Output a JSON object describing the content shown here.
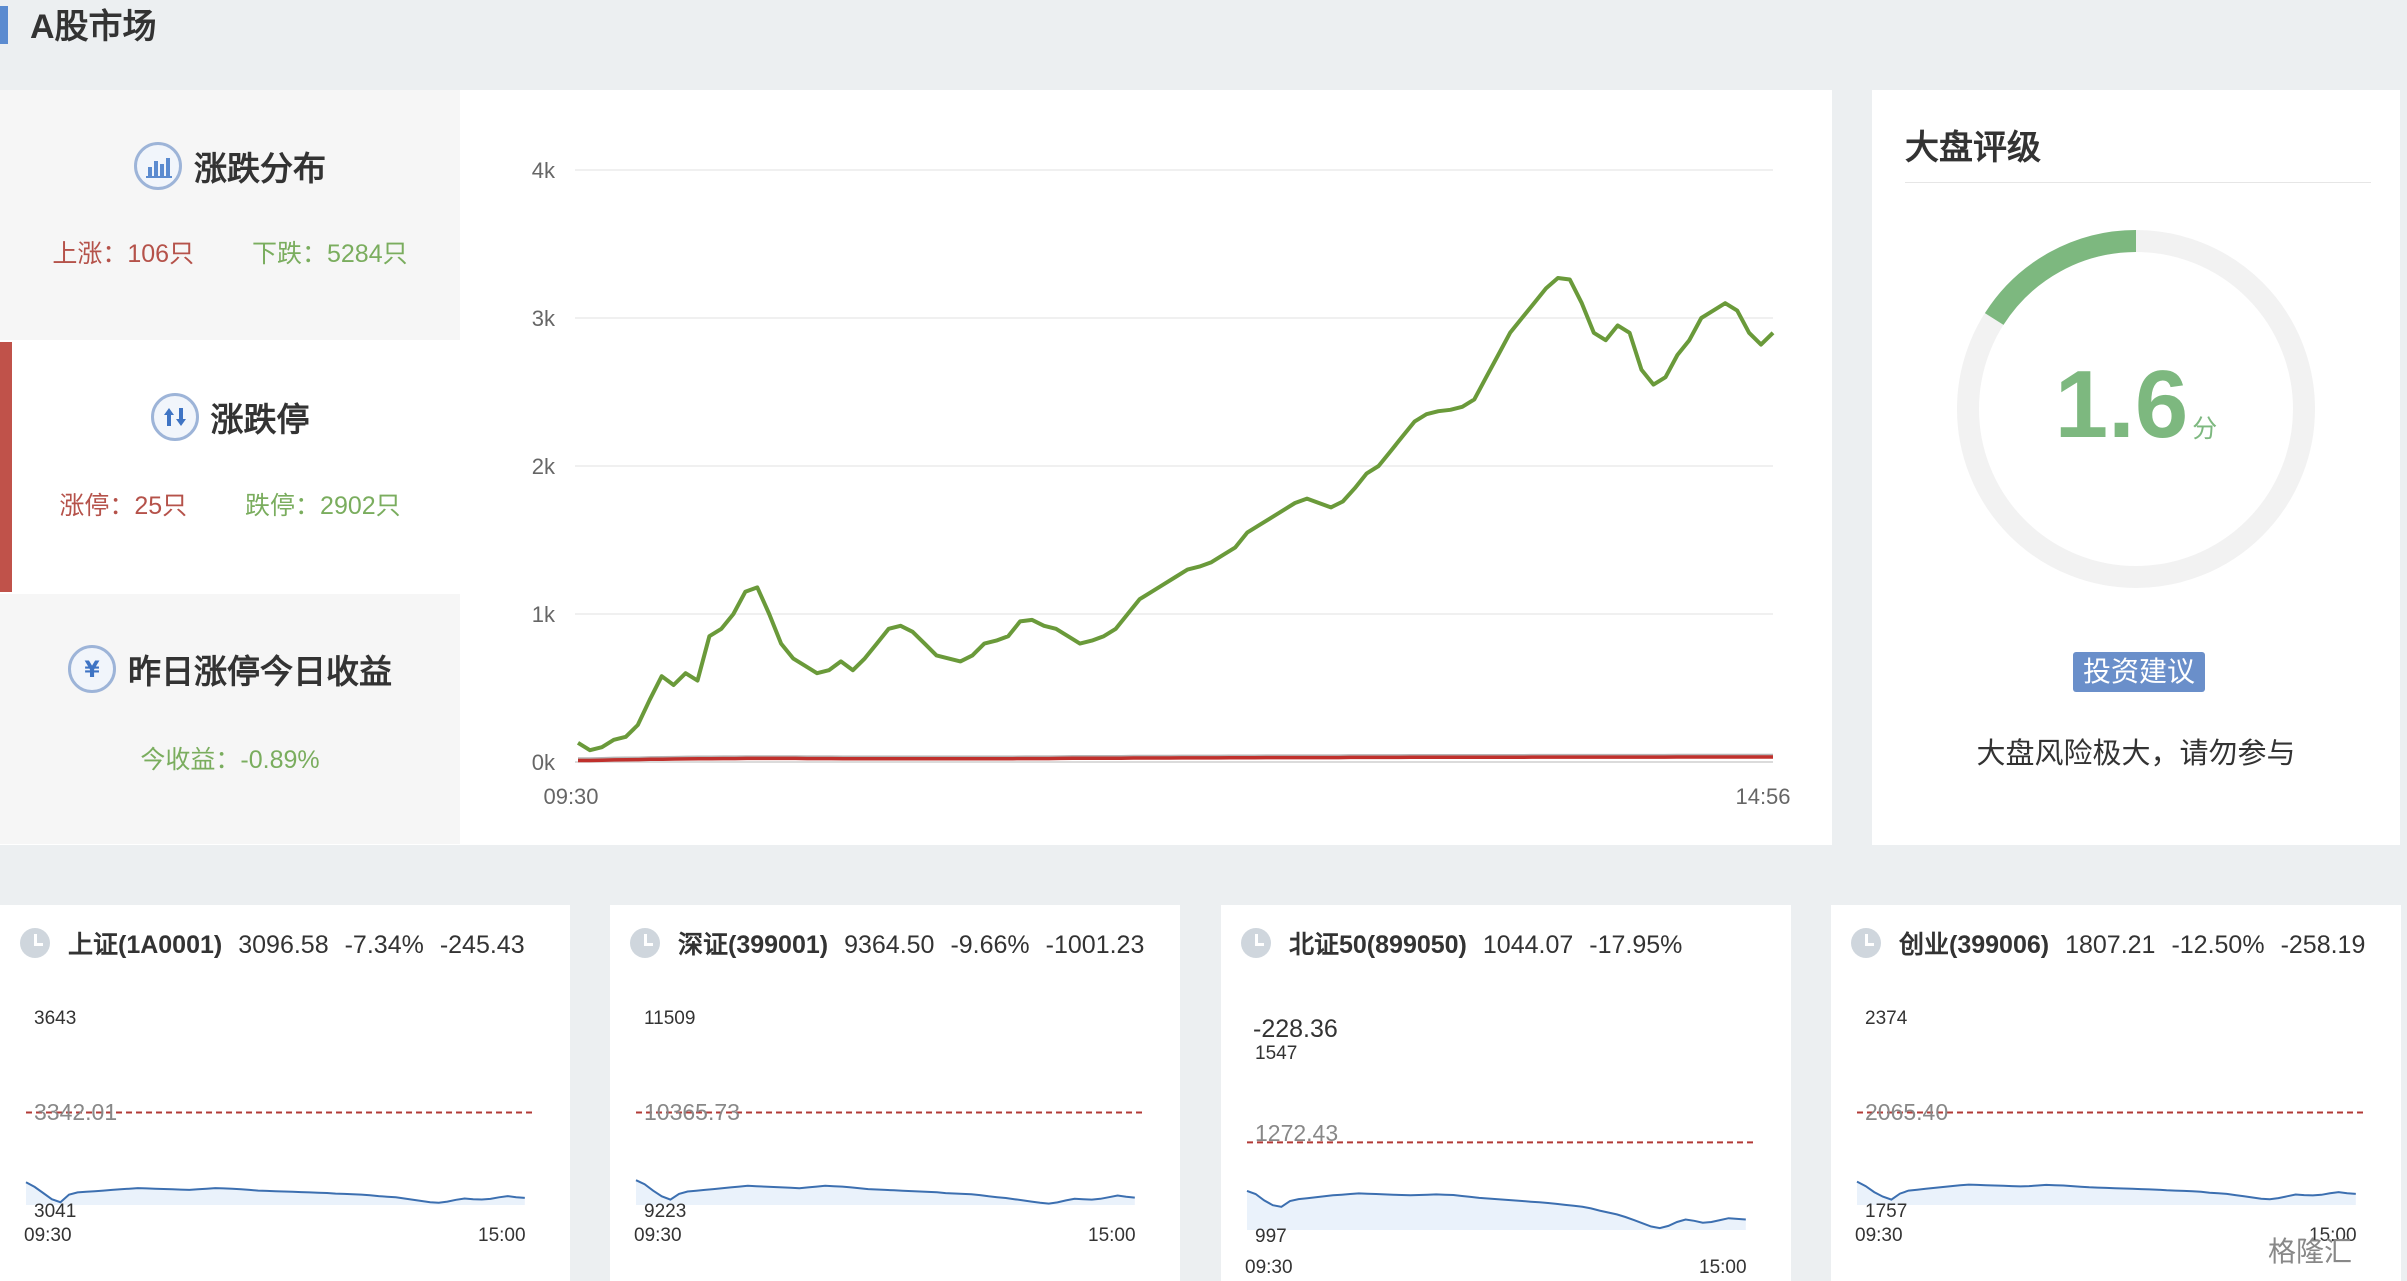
{
  "page": {
    "title": "A股市场"
  },
  "stats": [
    {
      "title": "涨跌分布",
      "icon": "bar-chart-icon",
      "left_label": "上涨：106只",
      "right_label": "下跌：5284只"
    },
    {
      "title": "涨跌停",
      "icon": "up-down-arrows-icon",
      "left_label": "涨停：25只",
      "right_label": "跌停：2902只"
    },
    {
      "title": "昨日涨停今日收益",
      "icon": "yen-icon",
      "left_label": "今收益：-0.89%",
      "right_label": ""
    }
  ],
  "chart_data": [
    {
      "type": "line",
      "title": "",
      "xlabel": "",
      "ylabel": "",
      "x_tick_labels": [
        "09:30",
        "14:56"
      ],
      "y_tick_labels": [
        "0k",
        "1k",
        "2k",
        "3k",
        "4k"
      ],
      "ylim": [
        0,
        4000
      ],
      "grid": true,
      "series": [
        {
          "color": "#6a9a3a",
          "values": [
            130,
            80,
            100,
            150,
            170,
            250,
            420,
            580,
            520,
            600,
            550,
            850,
            900,
            1000,
            1150,
            1180,
            1000,
            800,
            700,
            650,
            600,
            620,
            680,
            620,
            700,
            800,
            900,
            920,
            880,
            800,
            720,
            700,
            680,
            720,
            800,
            820,
            850,
            950,
            960,
            920,
            900,
            850,
            800,
            820,
            850,
            900,
            1000,
            1100,
            1150,
            1200,
            1250,
            1300,
            1320,
            1350,
            1400,
            1450,
            1550,
            1600,
            1650,
            1700,
            1750,
            1780,
            1750,
            1720,
            1760,
            1850,
            1950,
            2000,
            2100,
            2200,
            2300,
            2350,
            2370,
            2380,
            2400,
            2450,
            2600,
            2750,
            2900,
            3000,
            3100,
            3200,
            3270,
            3260,
            3100,
            2900,
            2850,
            2950,
            2900,
            2650,
            2550,
            2600,
            2750,
            2850,
            3000,
            3050,
            3100,
            3050,
            2900,
            2820,
            2900
          ]
        },
        {
          "color": "#c0302c",
          "values": [
            10,
            10,
            12,
            14,
            15,
            16,
            18,
            19,
            20,
            21,
            22,
            22,
            23,
            23,
            24,
            24,
            24,
            24,
            24,
            23,
            23,
            23,
            22,
            22,
            22,
            22,
            22,
            22,
            22,
            22,
            22,
            22,
            22,
            22,
            22,
            22,
            22,
            23,
            23,
            23,
            24,
            25,
            25,
            26,
            26,
            26,
            27,
            27,
            27,
            27,
            28,
            28,
            28,
            28,
            29,
            29,
            29,
            30,
            30,
            30,
            30,
            30,
            30,
            30,
            31,
            31,
            31,
            31,
            31,
            32,
            32,
            32,
            32,
            32,
            32,
            32,
            32,
            32,
            32,
            33,
            33,
            33,
            33,
            33,
            33,
            33,
            33,
            33,
            33,
            33,
            33,
            34,
            34,
            34,
            34,
            34,
            34,
            34,
            34,
            34
          ]
        },
        {
          "color": "#b5b5b5",
          "values": [
            20,
            20,
            22,
            24,
            25,
            26,
            28,
            29,
            30,
            31,
            32,
            32,
            33,
            33,
            34,
            34,
            34,
            34,
            34,
            33,
            33,
            33,
            32,
            32,
            32,
            32,
            32,
            32,
            32,
            32,
            32,
            32,
            32,
            32,
            32,
            32,
            32,
            33,
            33,
            33,
            34,
            35,
            35,
            36,
            36,
            36,
            37,
            37,
            37,
            37,
            38,
            38,
            38,
            38,
            39,
            39,
            39,
            40,
            40,
            40,
            40,
            40,
            40,
            40,
            41,
            41,
            41,
            41,
            41,
            42,
            42,
            42,
            42,
            42,
            42,
            42,
            42,
            42,
            42,
            43,
            43,
            43,
            43,
            43,
            43,
            43,
            43,
            43,
            43,
            43,
            43,
            44,
            44,
            44,
            44,
            44,
            44,
            44,
            44,
            44
          ]
        }
      ]
    },
    {
      "type": "line",
      "title": "上证(1A0001)",
      "x_tick_labels": [
        "09:30",
        "15:00"
      ],
      "ylim": [
        3041,
        3643
      ],
      "reference": 3342.01,
      "series": [
        {
          "color": "#3c6fb0",
          "values": [
            3115,
            3100,
            3080,
            3060,
            3050,
            3075,
            3082,
            3084,
            3086,
            3088,
            3090,
            3092,
            3094,
            3096,
            3095,
            3094,
            3093,
            3092,
            3091,
            3090,
            3092,
            3094,
            3096,
            3095,
            3094,
            3092,
            3090,
            3088,
            3087,
            3086,
            3085,
            3084,
            3083,
            3082,
            3081,
            3080,
            3078,
            3077,
            3076,
            3075,
            3073,
            3070,
            3068,
            3066,
            3062,
            3058,
            3054,
            3050,
            3048,
            3052,
            3058,
            3062,
            3060,
            3059,
            3061,
            3066,
            3070,
            3066,
            3064
          ]
        }
      ]
    },
    {
      "type": "line",
      "title": "深证(399001)",
      "x_tick_labels": [
        "09:30",
        "15:00"
      ],
      "ylim": [
        9223,
        11509
      ],
      "reference": 10365.73,
      "series": [
        {
          "color": "#3c6fb0",
          "values": [
            9530,
            9480,
            9400,
            9330,
            9290,
            9360,
            9390,
            9400,
            9410,
            9420,
            9430,
            9440,
            9450,
            9460,
            9455,
            9450,
            9445,
            9440,
            9435,
            9430,
            9440,
            9450,
            9460,
            9455,
            9450,
            9440,
            9430,
            9420,
            9415,
            9410,
            9405,
            9400,
            9395,
            9390,
            9385,
            9380,
            9370,
            9365,
            9360,
            9355,
            9345,
            9330,
            9320,
            9310,
            9295,
            9280,
            9265,
            9250,
            9240,
            9255,
            9280,
            9300,
            9295,
            9290,
            9300,
            9320,
            9340,
            9325,
            9315
          ]
        }
      ]
    },
    {
      "type": "line",
      "title": "北证50(899050)",
      "x_tick_labels": [
        "09:30",
        "15:00"
      ],
      "ylim": [
        997,
        1547
      ],
      "reference": 1272.43,
      "series": [
        {
          "color": "#3c6fb0",
          "values": [
            1120,
            1110,
            1090,
            1075,
            1070,
            1088,
            1094,
            1097,
            1100,
            1103,
            1106,
            1108,
            1110,
            1112,
            1111,
            1110,
            1109,
            1108,
            1107,
            1106,
            1107,
            1108,
            1109,
            1108,
            1107,
            1104,
            1101,
            1098,
            1096,
            1094,
            1092,
            1090,
            1088,
            1086,
            1084,
            1082,
            1079,
            1076,
            1073,
            1070,
            1065,
            1058,
            1052,
            1046,
            1038,
            1028,
            1018,
            1008,
            1003,
            1010,
            1022,
            1030,
            1026,
            1020,
            1022,
            1028,
            1034,
            1032,
            1030
          ]
        }
      ]
    },
    {
      "type": "line",
      "title": "创业(399006)",
      "x_tick_labels": [
        "09:30",
        "15:00"
      ],
      "ylim": [
        1757,
        2374
      ],
      "reference": 2065.4,
      "series": [
        {
          "color": "#3c6fb0",
          "values": [
            1835,
            1820,
            1800,
            1785,
            1775,
            1795,
            1805,
            1808,
            1811,
            1814,
            1817,
            1820,
            1823,
            1825,
            1824,
            1823,
            1822,
            1821,
            1820,
            1819,
            1820,
            1822,
            1824,
            1823,
            1822,
            1820,
            1818,
            1816,
            1815,
            1814,
            1813,
            1812,
            1811,
            1810,
            1809,
            1808,
            1806,
            1805,
            1804,
            1803,
            1801,
            1798,
            1796,
            1794,
            1790,
            1786,
            1782,
            1778,
            1776,
            1780,
            1786,
            1792,
            1790,
            1789,
            1791,
            1796,
            1800,
            1796,
            1794
          ]
        }
      ]
    }
  ],
  "rating": {
    "title": "大盘评级",
    "score": "1.6",
    "unit": "分",
    "score_fraction": 0.16,
    "ring_color": "#7db87f",
    "advice_label": "投资建议",
    "advice_text": "大盘风险极大，请勿参与"
  },
  "cards": [
    {
      "name": "上证(1A0001)",
      "price": "3096.58",
      "pct": "-7.34%",
      "chg": "-245.43",
      "extra": "",
      "y_top": "3643",
      "y_ref": "3342.01",
      "y_bottom": "3041",
      "t_start": "09:30",
      "t_end": "15:00"
    },
    {
      "name": "深证(399001)",
      "price": "9364.50",
      "pct": "-9.66%",
      "chg": "-1001.23",
      "extra": "",
      "y_top": "11509",
      "y_ref": "10365.73",
      "y_bottom": "9223",
      "t_start": "09:30",
      "t_end": "15:00"
    },
    {
      "name": "北证50(899050)",
      "price": "1044.07",
      "pct": "-17.95%",
      "chg": "",
      "extra": "-228.36",
      "y_top": "1547",
      "y_ref": "1272.43",
      "y_bottom": "997",
      "t_start": "09:30",
      "t_end": "15:00"
    },
    {
      "name": "创业(399006)",
      "price": "1807.21",
      "pct": "-12.50%",
      "chg": "-258.19",
      "extra": "",
      "y_top": "2374",
      "y_ref": "2065.40",
      "y_bottom": "1757",
      "t_start": "09:30",
      "t_end": "15:00"
    }
  ],
  "watermark": "格隆汇"
}
